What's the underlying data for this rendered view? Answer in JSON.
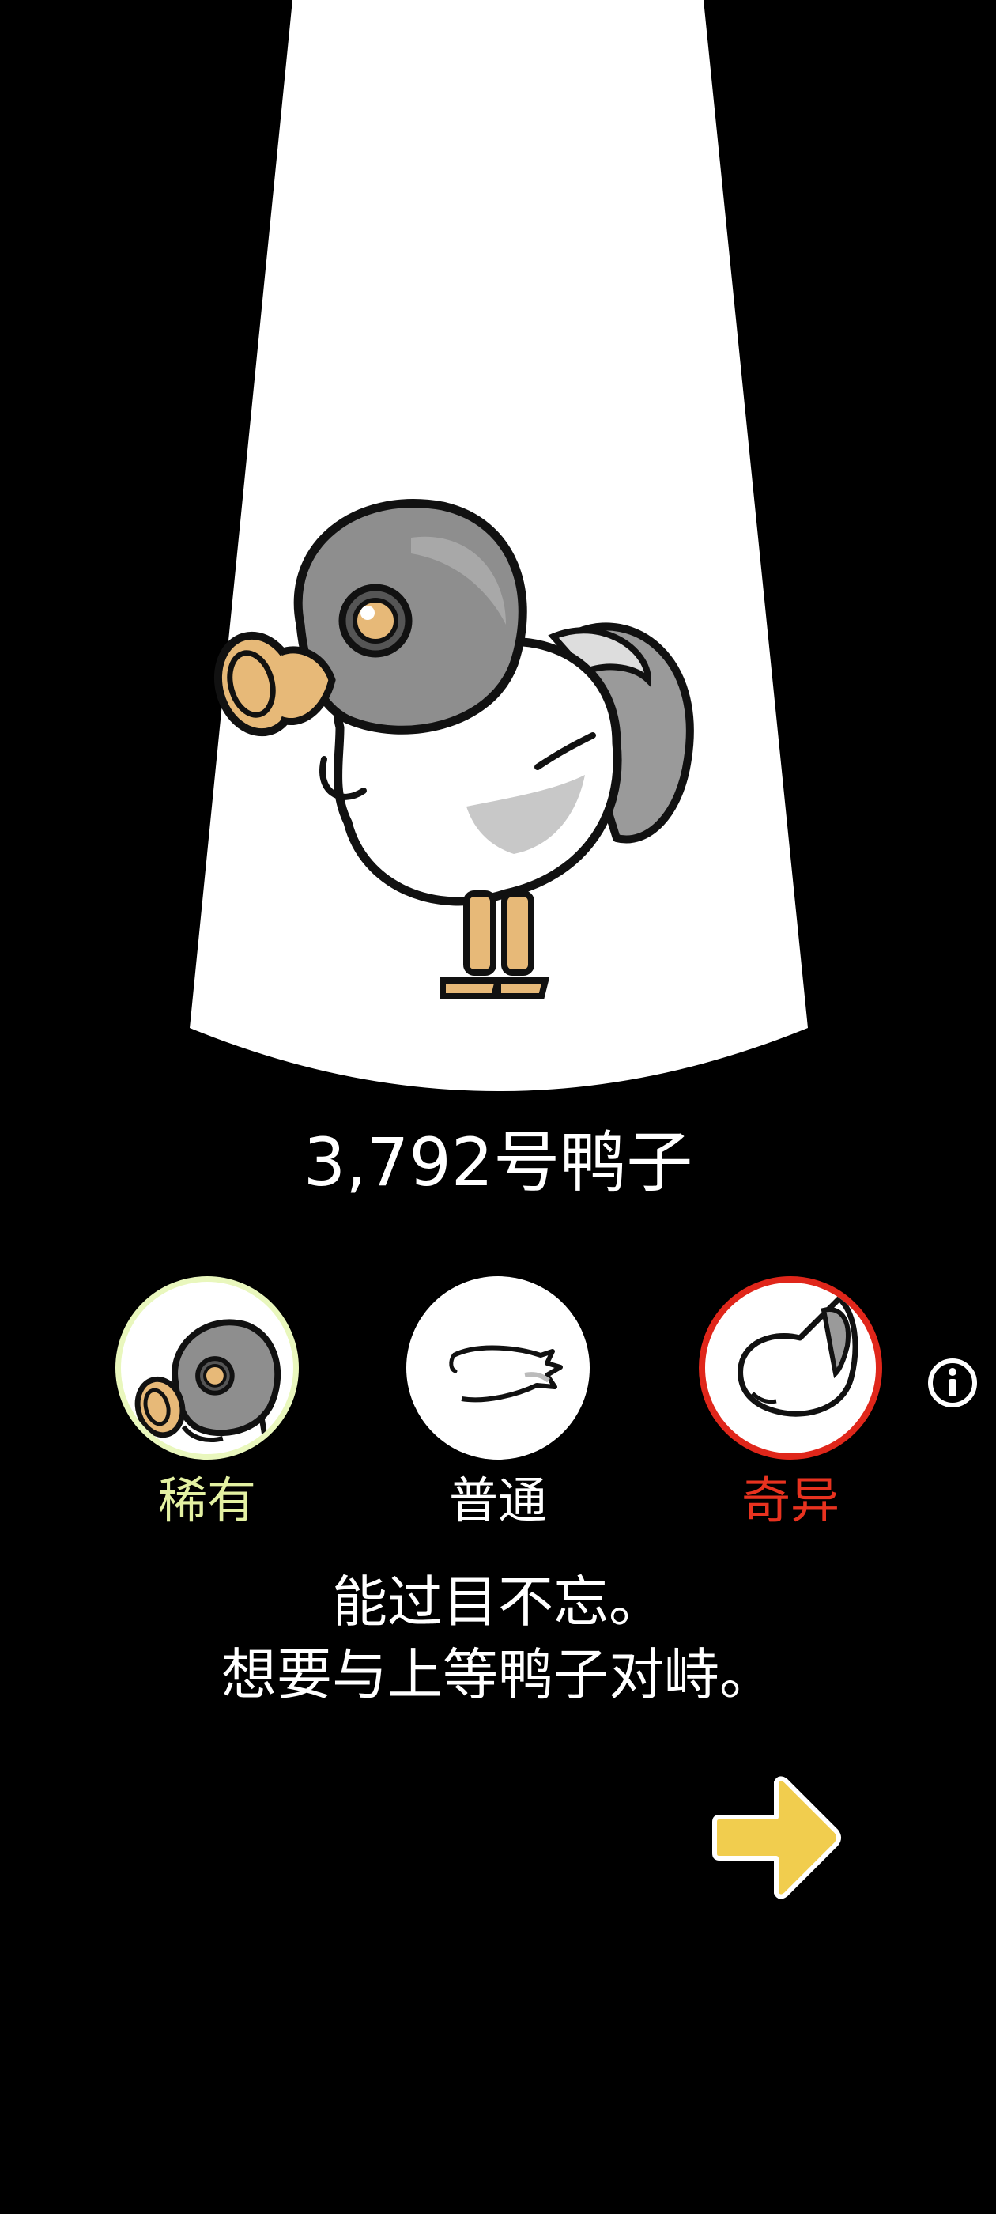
{
  "duck": {
    "name": "3,792号鸭子",
    "description_line1": "能过目不忘。",
    "description_line2": "想要与上等鸭子对峙。"
  },
  "parts": [
    {
      "id": "head",
      "label": "稀有",
      "rarity_color": "#e3f1a2",
      "icon": "gas-mask-head-icon"
    },
    {
      "id": "wing",
      "label": "普通",
      "rarity_color": "#ffffff",
      "icon": "wing-icon"
    },
    {
      "id": "tail",
      "label": "奇异",
      "rarity_color": "#e8321f",
      "icon": "curled-tail-icon"
    }
  ],
  "colors": {
    "background": "#000000",
    "spotlight": "#ffffff",
    "next_arrow": "#f1cd4e",
    "mask_gray": "#8e8e8e",
    "mask_filter": "#e7b978"
  },
  "icons": {
    "info": "info-icon",
    "next": "next-arrow-icon"
  }
}
